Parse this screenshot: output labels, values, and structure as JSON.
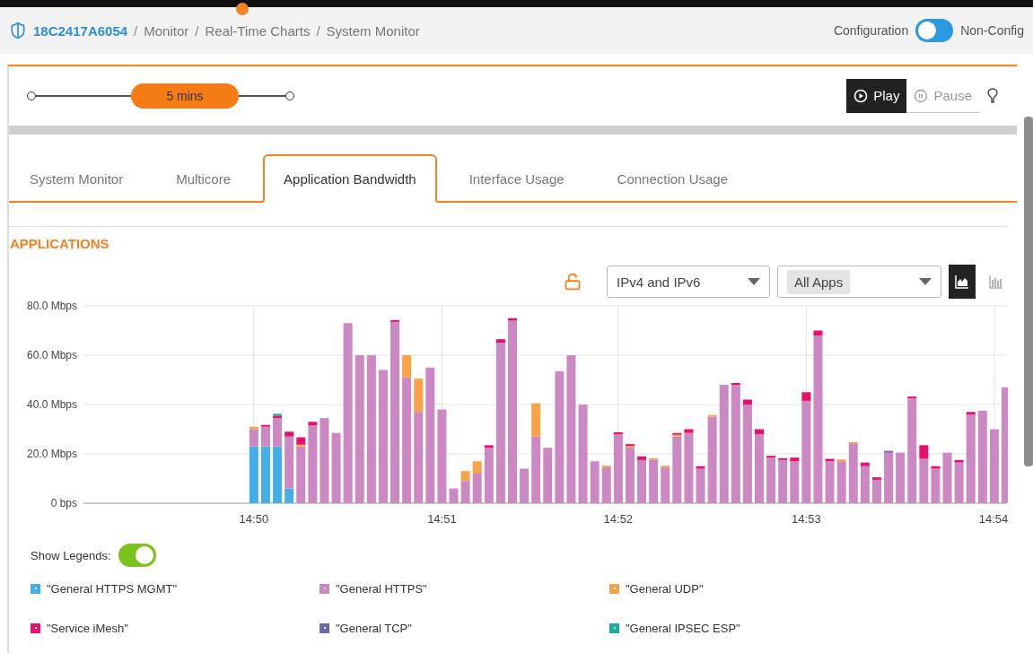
{
  "breadcrumb": {
    "device": "18C2417A6054",
    "items": [
      "Monitor",
      "Real-Time Charts",
      "System Monitor"
    ],
    "separator": "/"
  },
  "mode_switch": {
    "left_label": "Configuration",
    "right_label": "Non-Config",
    "on": false
  },
  "time_range": {
    "label": "5 mins"
  },
  "playback": [
    {
      "kind": "play",
      "label": "Play",
      "selected": true
    },
    {
      "kind": "pause",
      "label": "Pause",
      "selected": false
    }
  ],
  "tabs": [
    {
      "label": "System Monitor",
      "selected": false
    },
    {
      "label": "Multicore",
      "selected": false
    },
    {
      "label": "Application Bandwidth",
      "selected": true
    },
    {
      "label": "Interface Usage",
      "selected": false
    },
    {
      "label": "Connection Usage",
      "selected": false
    }
  ],
  "section_title": "APPLICATIONS",
  "filters": {
    "locked": false,
    "ip_version": "IPv4 and IPv6",
    "app_tag": "All Apps",
    "view_modes": [
      {
        "kind": "area",
        "selected": true
      },
      {
        "kind": "bar",
        "selected": false
      }
    ]
  },
  "chart_data": {
    "type": "bar",
    "stacked": true,
    "grid": true,
    "ylim": [
      0,
      80
    ],
    "categories": [
      null,
      null,
      null,
      null,
      null,
      null,
      null,
      null,
      null,
      null,
      null,
      null,
      null,
      null,
      "14:50",
      null,
      null,
      null,
      null,
      null,
      null,
      null,
      null,
      null,
      null,
      null,
      null,
      null,
      null,
      null,
      "14:51",
      null,
      null,
      null,
      null,
      null,
      null,
      null,
      null,
      null,
      null,
      null,
      null,
      null,
      null,
      "14:52",
      null,
      null,
      null,
      null,
      null,
      null,
      null,
      null,
      null,
      null,
      null,
      null,
      null,
      null,
      null,
      "14:53",
      null,
      null,
      null,
      null,
      null,
      null,
      null,
      null,
      null,
      null,
      null,
      null,
      null,
      null,
      null,
      "14:54",
      null
    ],
    "yticks": [
      {
        "value": 0,
        "label": "0 bps"
      },
      {
        "value": 20,
        "label": "20.0 Mbps"
      },
      {
        "value": 40,
        "label": "40.0 Mbps"
      },
      {
        "value": 60,
        "label": "60.0 Mbps"
      },
      {
        "value": 80,
        "label": "80.0 Mbps"
      }
    ],
    "series": [
      {
        "name": "\"General HTTPS MGMT\"",
        "color": "#45aee6",
        "values": [
          null,
          null,
          null,
          null,
          null,
          null,
          null,
          null,
          null,
          null,
          null,
          null,
          null,
          null,
          23,
          23,
          23,
          6,
          0,
          0,
          0,
          0,
          0,
          0,
          0,
          0,
          0,
          0,
          0,
          0,
          0,
          0,
          0,
          0,
          0,
          0,
          0,
          0,
          0,
          0,
          0,
          0,
          0,
          0,
          0,
          0,
          0,
          0,
          0,
          0,
          0,
          0,
          0,
          0,
          0,
          0,
          0,
          0,
          0,
          0,
          0,
          0,
          0,
          0,
          0,
          0,
          0,
          0,
          0,
          0,
          0,
          0,
          0,
          0,
          0,
          0,
          0,
          0,
          0
        ]
      },
      {
        "name": "\"General HTTPS\"",
        "color": "#cc88c2",
        "values": [
          null,
          null,
          null,
          null,
          null,
          null,
          null,
          null,
          null,
          null,
          null,
          null,
          null,
          null,
          7,
          8,
          11.5,
          21,
          23,
          31.5,
          34.5,
          28.5,
          73,
          60,
          60,
          54,
          73.5,
          51,
          37,
          55,
          38,
          6,
          9,
          12,
          22.5,
          65,
          74,
          14,
          27,
          22.5,
          53.5,
          60,
          40,
          17,
          14.5,
          28,
          22.5,
          17.5,
          17.5,
          14.5,
          27,
          28.5,
          14,
          35,
          48,
          48,
          40,
          28,
          18.5,
          17.5,
          17,
          41.5,
          68,
          17,
          17,
          24,
          15,
          9.5,
          20.5,
          20.5,
          42.5,
          18,
          14,
          20.5,
          16.5,
          36,
          37.5,
          30,
          47
        ]
      },
      {
        "name": "\"General UDP\"",
        "color": "#f9a24a",
        "values": [
          null,
          null,
          null,
          null,
          null,
          null,
          null,
          null,
          null,
          null,
          null,
          null,
          null,
          null,
          1,
          0,
          0,
          0,
          0.5,
          0,
          0,
          0,
          0,
          0,
          0,
          0,
          0,
          9,
          13.5,
          0,
          0,
          0,
          4,
          5,
          0,
          0,
          0,
          0,
          13.5,
          0,
          0,
          0,
          0,
          0,
          0.5,
          0,
          0.5,
          0,
          0.5,
          0.5,
          0.5,
          0,
          0,
          0.5,
          0,
          0,
          0,
          0,
          0,
          0,
          0,
          0,
          0,
          0,
          0.5,
          0.5,
          0,
          0,
          0,
          0,
          0,
          0,
          0,
          0,
          0,
          0,
          0,
          0,
          0
        ]
      },
      {
        "name": "\"Service iMesh\"",
        "color": "#e8106c",
        "values": [
          null,
          null,
          null,
          null,
          null,
          null,
          null,
          null,
          null,
          null,
          null,
          null,
          null,
          null,
          0,
          0.5,
          1,
          2,
          3,
          1.5,
          0,
          0,
          0,
          0,
          0,
          0,
          0.5,
          0,
          0,
          0,
          0,
          0,
          0,
          0,
          1,
          1.5,
          1,
          0,
          0,
          0,
          0,
          0,
          0,
          0,
          0,
          0.5,
          0.5,
          1.5,
          0,
          0,
          0.5,
          1.5,
          1,
          0,
          0,
          0.5,
          2,
          2,
          0.5,
          0.5,
          1.5,
          3.5,
          2,
          1,
          0,
          0,
          1.5,
          1,
          0,
          0,
          0.5,
          5.5,
          1,
          0,
          1,
          1,
          0,
          0,
          0
        ]
      },
      {
        "name": "\"General TCP\"",
        "color": "#6a6aad",
        "values": [
          null,
          null,
          null,
          null,
          null,
          null,
          null,
          null,
          null,
          null,
          null,
          null,
          null,
          null,
          0,
          0,
          0,
          0,
          0,
          0,
          0,
          0,
          0,
          0,
          0,
          0,
          0,
          0,
          0,
          0,
          0,
          0,
          0,
          0,
          0,
          0,
          0,
          0,
          0,
          0,
          0,
          0,
          0,
          0,
          0,
          0,
          0,
          0,
          0,
          0,
          0,
          0,
          0,
          0,
          0,
          0,
          0,
          0,
          0,
          0,
          0,
          0,
          0,
          0,
          0,
          0,
          0,
          0,
          0.5,
          0,
          0,
          0,
          0,
          0,
          0,
          0,
          0,
          0,
          0
        ]
      },
      {
        "name": "\"General IPSEC ESP\"",
        "color": "#1cae9c",
        "values": [
          null,
          null,
          null,
          null,
          null,
          null,
          null,
          null,
          null,
          null,
          null,
          null,
          null,
          null,
          0,
          0,
          0.3,
          0,
          0,
          0,
          0,
          0,
          0,
          0,
          0,
          0,
          0,
          0,
          0,
          0,
          0,
          0,
          0,
          0,
          0,
          0,
          0,
          0,
          0,
          0,
          0,
          0,
          0,
          0,
          0,
          0,
          0,
          0,
          0,
          0,
          0,
          0,
          0,
          0,
          0,
          0,
          0,
          0,
          0,
          0,
          0,
          0,
          0,
          0,
          0,
          0,
          0,
          0,
          0,
          0,
          0,
          0,
          0,
          0,
          0,
          0,
          0,
          0,
          0
        ]
      }
    ]
  },
  "show_legends": {
    "label": "Show Legends:",
    "on": true
  }
}
